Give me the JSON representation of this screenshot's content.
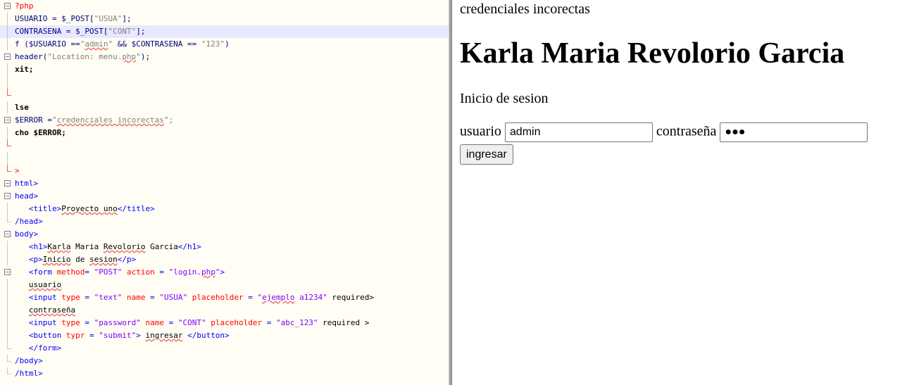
{
  "editor": {
    "lines": [
      {
        "fold": "box",
        "segs": [
          {
            "t": "?php",
            "c": "php"
          }
        ]
      },
      {
        "fold": "line",
        "hl": false,
        "segs": [
          {
            "t": "USUARIO = $_POST[",
            "c": "kw"
          },
          {
            "t": "\"USUA\"",
            "c": "str"
          },
          {
            "t": "];",
            "c": "kw"
          }
        ]
      },
      {
        "fold": "line",
        "hl": true,
        "segs": [
          {
            "t": "CONTRASENA = $_POST[",
            "c": "kw"
          },
          {
            "t": "\"CONT\"",
            "c": "str"
          },
          {
            "t": "];",
            "c": "kw"
          }
        ]
      },
      {
        "fold": "line",
        "segs": [
          {
            "t": "f ($USUARIO ==",
            "c": "kw"
          },
          {
            "t": "\"",
            "c": "str"
          },
          {
            "t": "admin",
            "c": "str sq"
          },
          {
            "t": "\"",
            "c": "str"
          },
          {
            "t": " && $CONTRASENA == ",
            "c": "kw"
          },
          {
            "t": "\"123\"",
            "c": "str"
          },
          {
            "t": ")",
            "c": "kw"
          }
        ]
      },
      {
        "fold": "box",
        "segs": [
          {
            "t": "header(",
            "c": "kw"
          },
          {
            "t": "\"Location: menu.",
            "c": "str"
          },
          {
            "t": "php",
            "c": "str sq"
          },
          {
            "t": "\"",
            "c": "str"
          },
          {
            "t": ");",
            "c": "kw"
          }
        ]
      },
      {
        "fold": "line",
        "segs": [
          {
            "t": "xit;",
            "c": "bold"
          }
        ]
      },
      {
        "fold": "line",
        "segs": []
      },
      {
        "fold": "endred",
        "segs": []
      },
      {
        "fold": "line",
        "segs": [
          {
            "t": "lse",
            "c": "bold"
          }
        ]
      },
      {
        "fold": "box",
        "segs": [
          {
            "t": "$ERROR =",
            "c": "kw"
          },
          {
            "t": "\"",
            "c": "str"
          },
          {
            "t": "credenciales incorectas",
            "c": "str sq"
          },
          {
            "t": "\";",
            "c": "str"
          }
        ]
      },
      {
        "fold": "line",
        "segs": [
          {
            "t": "cho $ERROR;",
            "c": "bold"
          }
        ]
      },
      {
        "fold": "endred",
        "segs": []
      },
      {
        "fold": "line",
        "segs": []
      },
      {
        "fold": "endred",
        "segs": [
          {
            "t": ">",
            "c": "php"
          }
        ]
      },
      {
        "fold": "box",
        "segs": [
          {
            "t": "html>",
            "c": "tag"
          }
        ]
      },
      {
        "fold": "box",
        "segs": [
          {
            "t": "head>",
            "c": "tag"
          }
        ]
      },
      {
        "fold": "line",
        "segs": [
          {
            "t": "   <title>",
            "c": "tag"
          },
          {
            "t": "Proyecto uno",
            "c": "sq"
          },
          {
            "t": "</title>",
            "c": "tag"
          }
        ]
      },
      {
        "fold": "end",
        "segs": [
          {
            "t": "/head>",
            "c": "tag"
          }
        ]
      },
      {
        "fold": "box",
        "segs": [
          {
            "t": "body>",
            "c": "tag"
          }
        ]
      },
      {
        "fold": "line",
        "segs": [
          {
            "t": "   <h1>",
            "c": "tag"
          },
          {
            "t": "Karla",
            "c": "sq"
          },
          {
            "t": " Maria ",
            "c": ""
          },
          {
            "t": "Revolorio",
            "c": "sq"
          },
          {
            "t": " Garcia",
            "c": ""
          },
          {
            "t": "</h1>",
            "c": "tag"
          }
        ]
      },
      {
        "fold": "line",
        "segs": [
          {
            "t": "   <p>",
            "c": "tag"
          },
          {
            "t": "Inicio",
            "c": "sq"
          },
          {
            "t": " de ",
            "c": ""
          },
          {
            "t": "sesion",
            "c": "sq"
          },
          {
            "t": "</p>",
            "c": "tag"
          }
        ]
      },
      {
        "fold": "box",
        "segs": [
          {
            "t": "   <form ",
            "c": "tag"
          },
          {
            "t": "method",
            "c": "attr"
          },
          {
            "t": "= ",
            "c": "tag"
          },
          {
            "t": "\"POST\"",
            "c": "val"
          },
          {
            "t": " ",
            "c": ""
          },
          {
            "t": "action",
            "c": "attr"
          },
          {
            "t": " = ",
            "c": "tag"
          },
          {
            "t": "\"login.",
            "c": "val"
          },
          {
            "t": "php",
            "c": "val sq"
          },
          {
            "t": "\"",
            "c": "val"
          },
          {
            "t": ">",
            "c": "tag"
          }
        ]
      },
      {
        "fold": "line",
        "segs": [
          {
            "t": "   ",
            "c": ""
          },
          {
            "t": "usuario",
            "c": "sq"
          }
        ]
      },
      {
        "fold": "line",
        "segs": [
          {
            "t": "   <input ",
            "c": "tag"
          },
          {
            "t": "type",
            "c": "attr"
          },
          {
            "t": " = ",
            "c": "tag"
          },
          {
            "t": "\"text\"",
            "c": "val"
          },
          {
            "t": " ",
            "c": ""
          },
          {
            "t": "name",
            "c": "attr"
          },
          {
            "t": " = ",
            "c": "tag"
          },
          {
            "t": "\"USUA\"",
            "c": "val"
          },
          {
            "t": " ",
            "c": ""
          },
          {
            "t": "placeholder",
            "c": "attr"
          },
          {
            "t": " = ",
            "c": "tag"
          },
          {
            "t": "\"",
            "c": "val"
          },
          {
            "t": "ejemplo",
            "c": "val sq"
          },
          {
            "t": " a1234\"",
            "c": "val"
          },
          {
            "t": " required>",
            "c": ""
          }
        ]
      },
      {
        "fold": "line",
        "segs": [
          {
            "t": "   ",
            "c": ""
          },
          {
            "t": "contraseña",
            "c": "sq"
          }
        ]
      },
      {
        "fold": "line",
        "segs": [
          {
            "t": "   <input ",
            "c": "tag"
          },
          {
            "t": "type",
            "c": "attr"
          },
          {
            "t": " = ",
            "c": "tag"
          },
          {
            "t": "\"password\"",
            "c": "val"
          },
          {
            "t": " ",
            "c": ""
          },
          {
            "t": "name",
            "c": "attr"
          },
          {
            "t": " = ",
            "c": "tag"
          },
          {
            "t": "\"CONT\"",
            "c": "val"
          },
          {
            "t": " ",
            "c": ""
          },
          {
            "t": "placeholder",
            "c": "attr"
          },
          {
            "t": " = ",
            "c": "tag"
          },
          {
            "t": "\"abc_123\"",
            "c": "val"
          },
          {
            "t": " required >",
            "c": ""
          }
        ]
      },
      {
        "fold": "line",
        "segs": [
          {
            "t": "   <button ",
            "c": "tag"
          },
          {
            "t": "typr",
            "c": "attr"
          },
          {
            "t": " = ",
            "c": "tag"
          },
          {
            "t": "\"submit\"",
            "c": "val"
          },
          {
            "t": "> ",
            "c": "tag"
          },
          {
            "t": "ingresar",
            "c": "sq"
          },
          {
            "t": " </button>",
            "c": "tag"
          }
        ]
      },
      {
        "fold": "end",
        "segs": [
          {
            "t": "   </form>",
            "c": "tag"
          }
        ]
      },
      {
        "fold": "end",
        "segs": [
          {
            "t": "/body>",
            "c": "tag"
          }
        ]
      },
      {
        "fold": "end",
        "segs": [
          {
            "t": "/html>",
            "c": "tag"
          }
        ]
      }
    ]
  },
  "browser": {
    "error_message": "credenciales incorectas",
    "heading": "Karla Maria Revolorio Garcia",
    "subtitle": "Inicio de sesion",
    "user_label": "usuario",
    "user_value": "admin",
    "password_label": "contraseña",
    "password_value": "●●●",
    "submit_label": "ingresar"
  }
}
